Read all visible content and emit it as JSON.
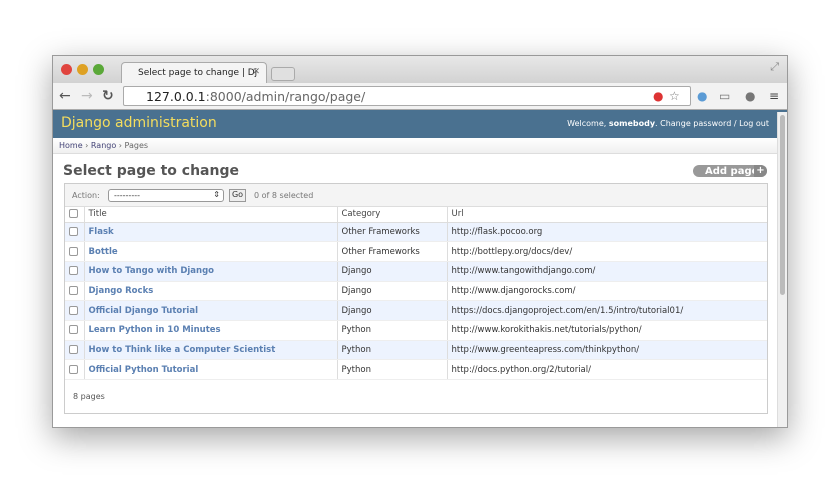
{
  "browser": {
    "tab_title": "Select page to change | Dj",
    "url_host": "127.0.0.1",
    "url_rest": ":8000/admin/rango/page/"
  },
  "header": {
    "brand": "Django administration",
    "welcome": "Welcome, ",
    "user": "somebody",
    "change_password": "Change password",
    "sep": " / ",
    "logout": "Log out"
  },
  "breadcrumbs": [
    "Home",
    "Rango",
    "Pages"
  ],
  "title": "Select page to change",
  "add_button": "Add page",
  "actions": {
    "label": "Action:",
    "selected": "---------",
    "go": "Go",
    "count": "0 of 8 selected"
  },
  "columns": [
    "Title",
    "Category",
    "Url"
  ],
  "rows": [
    {
      "title": "Flask",
      "category": "Other Frameworks",
      "url": "http://flask.pocoo.org"
    },
    {
      "title": "Bottle",
      "category": "Other Frameworks",
      "url": "http://bottlepy.org/docs/dev/"
    },
    {
      "title": "How to Tango with Django",
      "category": "Django",
      "url": "http://www.tangowithdjango.com/"
    },
    {
      "title": "Django Rocks",
      "category": "Django",
      "url": "http://www.djangorocks.com/"
    },
    {
      "title": "Official Django Tutorial",
      "category": "Django",
      "url": "https://docs.djangoproject.com/en/1.5/intro/tutorial01/"
    },
    {
      "title": "Learn Python in 10 Minutes",
      "category": "Python",
      "url": "http://www.korokithakis.net/tutorials/python/"
    },
    {
      "title": "How to Think like a Computer Scientist",
      "category": "Python",
      "url": "http://www.greenteapress.com/thinkpython/"
    },
    {
      "title": "Official Python Tutorial",
      "category": "Python",
      "url": "http://docs.python.org/2/tutorial/"
    }
  ],
  "footer": "8 pages",
  "colors": {
    "header": "#4a7190",
    "brand": "#f5dd5d",
    "link": "#5b80b2",
    "row_alt": "#edf3fe"
  }
}
